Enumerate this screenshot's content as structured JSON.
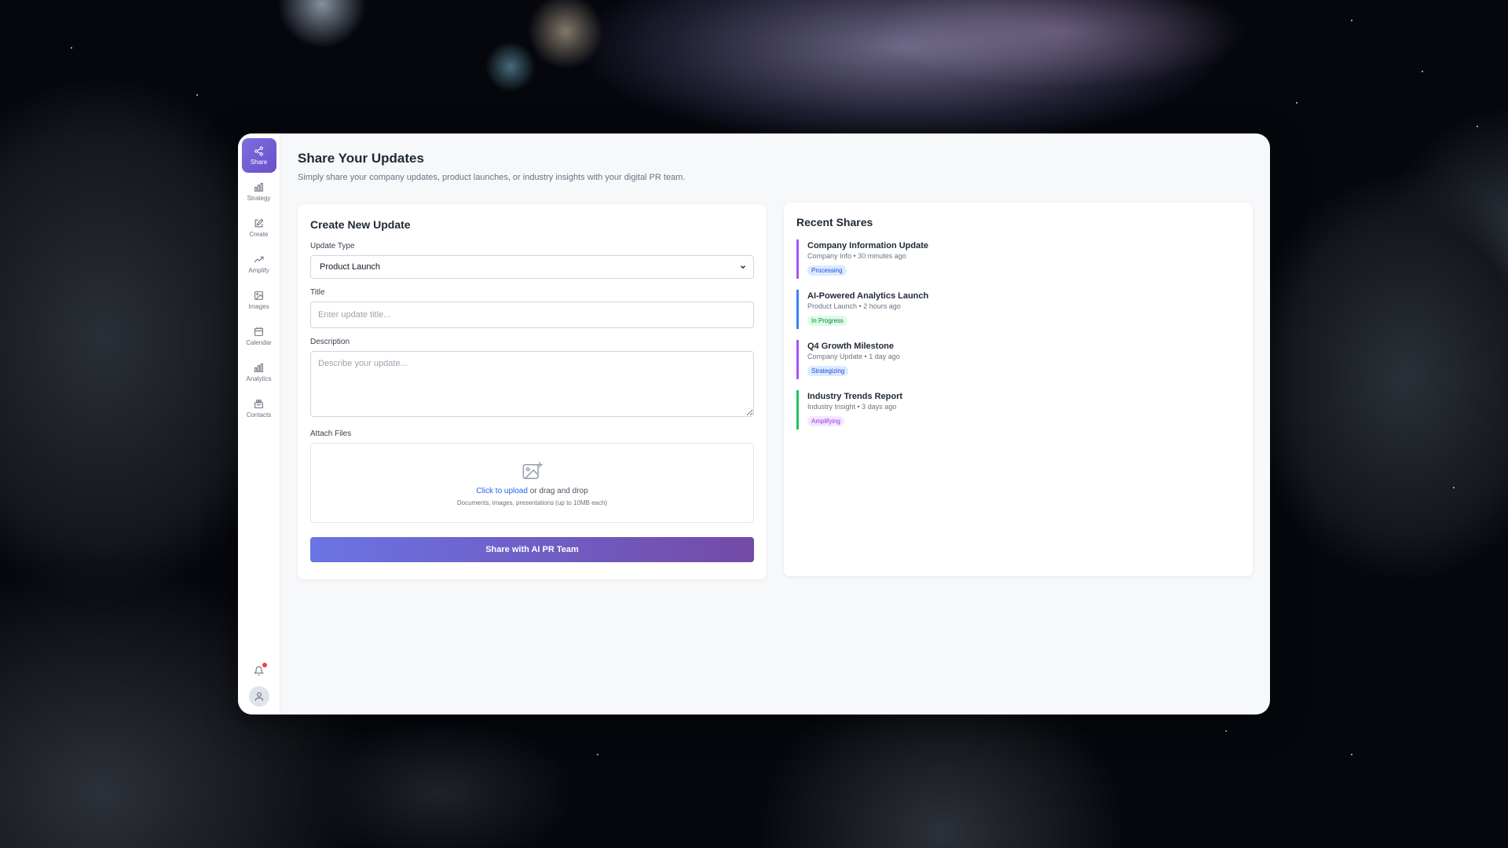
{
  "sidebar": {
    "items": [
      {
        "label": "Share",
        "icon": "share-icon"
      },
      {
        "label": "Strategy",
        "icon": "bar-chart-icon"
      },
      {
        "label": "Create",
        "icon": "edit-icon"
      },
      {
        "label": "Amplify",
        "icon": "trending-up-icon"
      },
      {
        "label": "Images",
        "icon": "image-icon"
      },
      {
        "label": "Calendar",
        "icon": "calendar-icon"
      },
      {
        "label": "Analytics",
        "icon": "bar-chart-icon"
      },
      {
        "label": "Contacts",
        "icon": "contacts-icon"
      }
    ],
    "notification_icon": "bell-icon",
    "avatar_icon": "user-icon"
  },
  "page": {
    "title": "Share Your Updates",
    "subtitle": "Simply share your company updates, product launches, or industry insights with your digital PR team."
  },
  "create": {
    "title": "Create New Update",
    "type_label": "Update Type",
    "type_value": "Product Launch",
    "title_label": "Title",
    "title_placeholder": "Enter update title...",
    "description_label": "Description",
    "description_placeholder": "Describe your update...",
    "attach_label": "Attach Files",
    "upload_link": "Click to upload",
    "upload_text": " or drag and drop",
    "upload_hint": "Documents, images, presentations (up to 10MB each)",
    "submit_label": "Share with AI PR Team"
  },
  "recent": {
    "title": "Recent Shares",
    "items": [
      {
        "title": "Company Information Update",
        "meta": "Company Info • 30 minutes ago",
        "status": "Processing",
        "accent": "#a855f7",
        "badge_bg": "#dbeafe",
        "badge_fg": "#1d4ed8"
      },
      {
        "title": "AI-Powered Analytics Launch",
        "meta": "Product Launch • 2 hours ago",
        "status": "In Progress",
        "accent": "#3b82f6",
        "badge_bg": "#dcfce7",
        "badge_fg": "#15803d"
      },
      {
        "title": "Q4 Growth Milestone",
        "meta": "Company Update • 1 day ago",
        "status": "Strategizing",
        "accent": "#a855f7",
        "badge_bg": "#dbeafe",
        "badge_fg": "#1d4ed8"
      },
      {
        "title": "Industry Trends Report",
        "meta": "Industry Insight • 3 days ago",
        "status": "Amplifying",
        "accent": "#22c55e",
        "badge_bg": "#f3e8ff",
        "badge_fg": "#9333ea"
      }
    ]
  }
}
